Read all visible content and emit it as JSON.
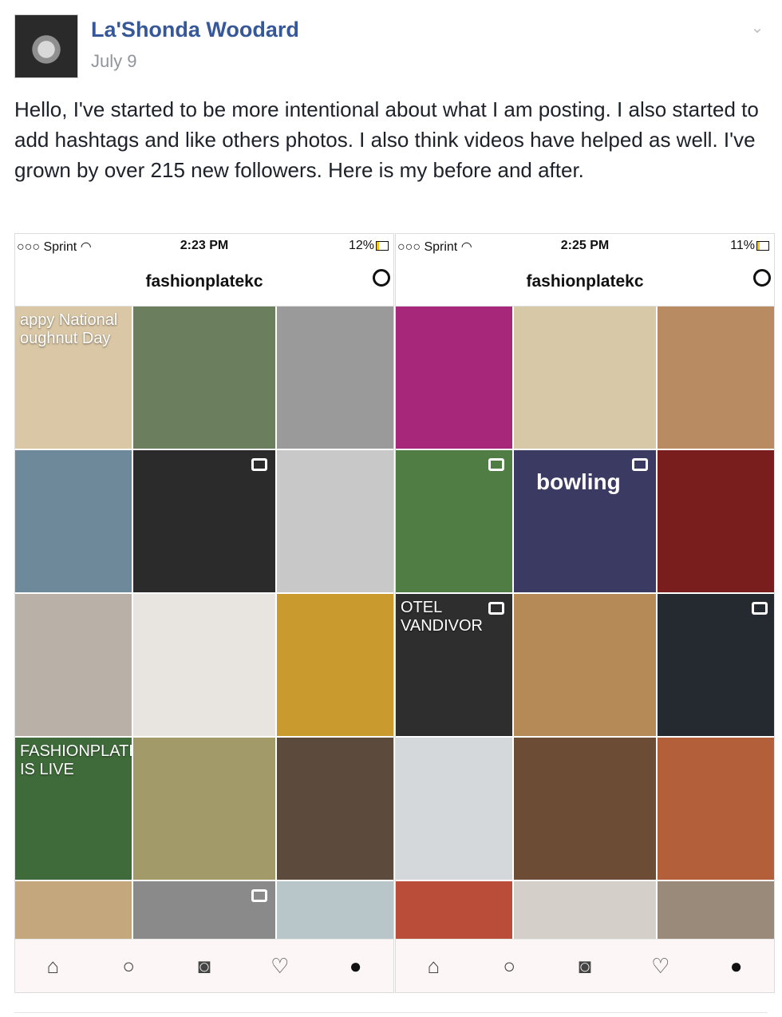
{
  "post": {
    "author": "La'Shonda Woodard",
    "date": "July 9",
    "text": "Hello, I've started to be more intentional about what I am posting. I also started to add hashtags and like others photos. I also think videos have helped as well. I've grown by over 215 new followers. Here is my before and after."
  },
  "phones": [
    {
      "carrier": "Sprint",
      "time": "2:23 PM",
      "battery": "12%",
      "username": "fashionplatekc",
      "tiles": [
        {
          "color": "#d9c7a6",
          "text": "appy National\noughnut Day",
          "video": false
        },
        {
          "color": "#6b7f5e",
          "text": "",
          "video": false
        },
        {
          "color": "#9a9a9a",
          "text": "",
          "video": false
        },
        {
          "color": "#6e8a9a",
          "text": "",
          "video": false
        },
        {
          "color": "#2b2b2b",
          "text": "",
          "video": true
        },
        {
          "color": "#c8c8c8",
          "text": "",
          "video": false
        },
        {
          "color": "#b9b1a7",
          "text": "",
          "video": false
        },
        {
          "color": "#e8e4df",
          "text": "",
          "video": false
        },
        {
          "color": "#c99a2e",
          "text": "",
          "video": false
        },
        {
          "color": "#3f6b3a",
          "text": "FASHIONPLATEKC.TV\nIS LIVE",
          "video": false
        },
        {
          "color": "#a39a6a",
          "text": "",
          "video": false
        },
        {
          "color": "#5c4a3c",
          "text": "",
          "video": false
        },
        {
          "color": "#c5a77d",
          "text": "",
          "video": false
        },
        {
          "color": "#8a8a8a",
          "text": "",
          "video": true
        },
        {
          "color": "#b8c5c9",
          "text": "",
          "video": false
        }
      ]
    },
    {
      "carrier": "Sprint",
      "time": "2:25 PM",
      "battery": "11%",
      "username": "fashionplatekc",
      "tiles": [
        {
          "color": "#a7287a",
          "text": "",
          "video": false
        },
        {
          "color": "#d7c9a8",
          "text": "",
          "video": false
        },
        {
          "color": "#b98b63",
          "text": "",
          "video": false
        },
        {
          "color": "#4f7d44",
          "text": "",
          "video": true
        },
        {
          "color": "#3b3a63",
          "text": "bowling",
          "video": true
        },
        {
          "color": "#7a1d1d",
          "text": "",
          "video": false
        },
        {
          "color": "#2e2e2e",
          "text": "OTEL VANDIVOR",
          "video": true
        },
        {
          "color": "#b58a56",
          "text": "",
          "video": false
        },
        {
          "color": "#252a30",
          "text": "",
          "video": true
        },
        {
          "color": "#d5d8da",
          "text": "",
          "video": false
        },
        {
          "color": "#6d4c36",
          "text": "",
          "video": false
        },
        {
          "color": "#b3603a",
          "text": "",
          "video": false
        },
        {
          "color": "#b94d3a",
          "text": "",
          "video": false
        },
        {
          "color": "#d4cfc8",
          "text": "",
          "video": false
        },
        {
          "color": "#9a8a7a",
          "text": "",
          "video": false
        }
      ]
    }
  ],
  "tabbar": [
    "home-icon",
    "search-icon",
    "camera-icon",
    "heart-icon",
    "profile-icon"
  ]
}
